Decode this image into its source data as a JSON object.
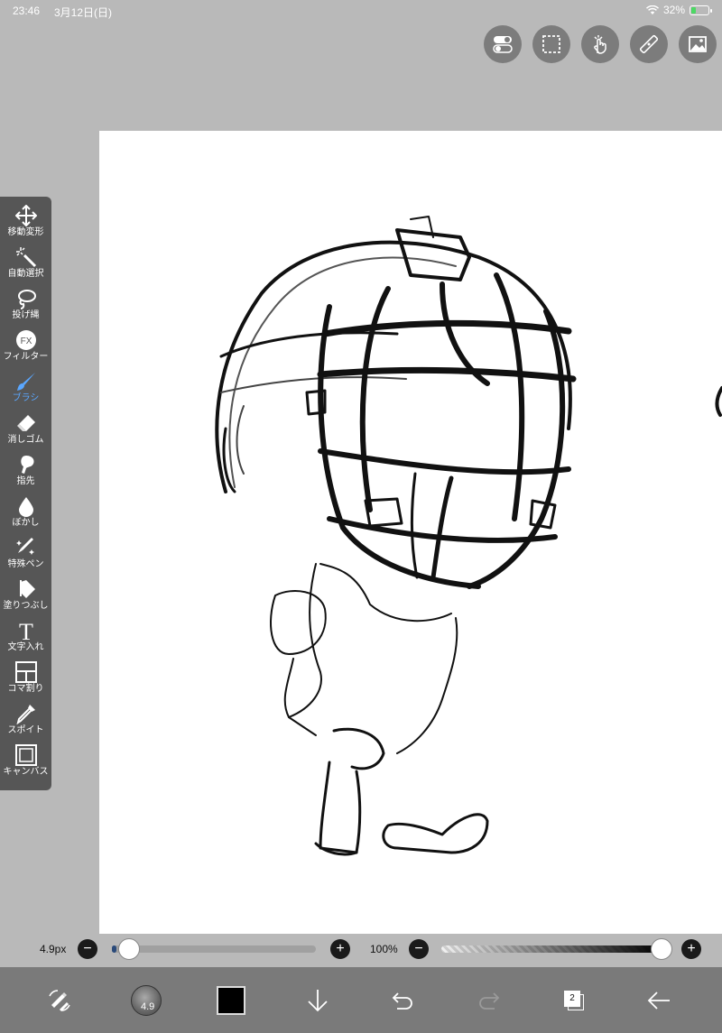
{
  "status": {
    "time": "23:46",
    "date": "3月12日(日)",
    "battery": "32%",
    "battery_fraction": 0.32
  },
  "top_tools": [
    "toggle-icon",
    "selection-icon",
    "gesture-icon",
    "ruler-icon",
    "image-icon"
  ],
  "left_toolbar": [
    {
      "icon": "move-transform-icon",
      "label": "移動変形"
    },
    {
      "icon": "magic-wand-icon",
      "label": "自動選択"
    },
    {
      "icon": "lasso-icon",
      "label": "投げ縄"
    },
    {
      "icon": "fx-icon",
      "label": "フィルター",
      "glyph": "FX"
    },
    {
      "icon": "brush-icon",
      "label": "ブラシ",
      "active": true
    },
    {
      "icon": "eraser-icon",
      "label": "消しゴム"
    },
    {
      "icon": "finger-icon",
      "label": "指先"
    },
    {
      "icon": "blur-icon",
      "label": "ぼかし"
    },
    {
      "icon": "special-pen-icon",
      "label": "特殊ペン"
    },
    {
      "icon": "fill-icon",
      "label": "塗りつぶし"
    },
    {
      "icon": "text-icon",
      "label": "文字入れ",
      "glyph": "T"
    },
    {
      "icon": "panel-divide-icon",
      "label": "コマ割り"
    },
    {
      "icon": "eyedropper-icon",
      "label": "スポイト"
    },
    {
      "icon": "canvas-icon",
      "label": "キャンバス"
    }
  ],
  "brush_size": {
    "label": "4.9px",
    "value_fraction": 0.02
  },
  "opacity": {
    "label": "100%",
    "value_fraction": 1.0
  },
  "bottom_bar": {
    "brush_preview_size": "4.9",
    "color": "#000000",
    "layer_count": "2"
  },
  "colors": {
    "accent": "#5aa7ff"
  }
}
